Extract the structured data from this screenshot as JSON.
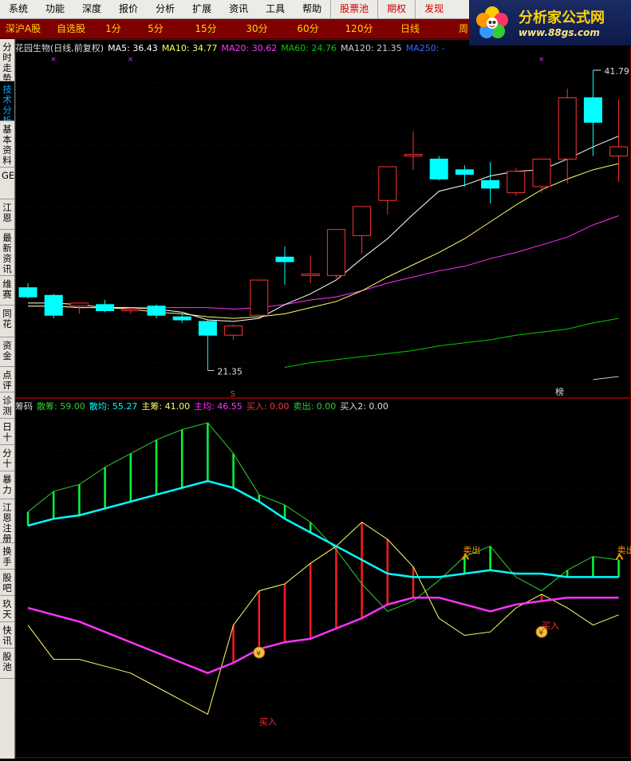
{
  "menu": {
    "items": [
      "系统",
      "功能",
      "深度",
      "报价",
      "分析",
      "扩展",
      "资讯",
      "工具",
      "帮助"
    ],
    "red_items": [
      "股票池",
      "期权",
      "发现"
    ]
  },
  "logo": {
    "title": "分析家公式网",
    "url": "www.88gs.com"
  },
  "periods": [
    "深沪A股",
    "自选股",
    "1分",
    "5分",
    "15分",
    "30分",
    "60分",
    "120分",
    "日线",
    "周"
  ],
  "left_tabs": [
    {
      "label": "分时走势",
      "state": "normal"
    },
    {
      "label": "技术分析",
      "state": "active"
    },
    {
      "label": "基本资料",
      "state": "normal"
    },
    {
      "label": "GET",
      "state": "normal"
    },
    {
      "label": "江恩",
      "state": "normal"
    },
    {
      "label": "最新资讯",
      "state": "normal"
    },
    {
      "label": "维赛",
      "state": "normal"
    },
    {
      "label": "同花",
      "state": "normal"
    },
    {
      "label": "资金",
      "state": "normal"
    },
    {
      "label": "点评",
      "state": "normal"
    },
    {
      "label": "诊测",
      "state": "normal"
    },
    {
      "label": "日十",
      "state": "normal"
    },
    {
      "label": "分十",
      "state": "normal"
    },
    {
      "label": "暴力",
      "state": "normal"
    },
    {
      "label": "江恩注册",
      "state": "normal"
    },
    {
      "label": "换手",
      "state": "normal"
    },
    {
      "label": "股吧",
      "state": "normal"
    },
    {
      "label": "玖天",
      "state": "normal"
    },
    {
      "label": "快讯",
      "state": "normal"
    },
    {
      "label": "股池",
      "state": "normal"
    }
  ],
  "main_info": {
    "title": "花园生物(日线,前复权)",
    "ma5": "MA5: 36.43",
    "ma10": "MA10: 34.77",
    "ma20": "MA20: 30.62",
    "ma60": "MA60: 24.76",
    "ma120": "MA120: 21.35",
    "ma250": "MA250: -"
  },
  "sub_info": {
    "title": "筹码",
    "sancou": "散筹: 59.00",
    "sanjun": "散均: 55.27",
    "zhucou": "主筹: 41.00",
    "zhujun": "主均: 46.55",
    "buy": "买入: 0.00",
    "sell": "卖出: 0.00",
    "buy2": "买入2: 0.00"
  },
  "annotations": {
    "high_label": "41.79",
    "low_label": "21.35",
    "s_marker": "S",
    "bang_marker": "榜",
    "buy_text": "买入",
    "sell_text": "卖出"
  },
  "colors": {
    "up": "#ff3333",
    "down": "#00ffff",
    "ma5": "#ffffff",
    "ma10": "#ffff66",
    "ma20": "#ff33ff",
    "ma60": "#00cc00",
    "ma120": "#cccccc",
    "chip_light": "#00ffff",
    "chip_main": "#ff33ff"
  },
  "candles": [
    {
      "o": 27.6,
      "h": 27.9,
      "l": 26.9,
      "c": 27.0
    },
    {
      "o": 27.1,
      "h": 27.2,
      "l": 25.6,
      "c": 25.8
    },
    {
      "o": 26.4,
      "h": 26.6,
      "l": 25.9,
      "c": 26.6
    },
    {
      "o": 26.5,
      "h": 26.8,
      "l": 26.0,
      "c": 26.1
    },
    {
      "o": 26.1,
      "h": 26.3,
      "l": 25.9,
      "c": 26.2
    },
    {
      "o": 26.4,
      "h": 26.5,
      "l": 25.6,
      "c": 25.8
    },
    {
      "o": 25.7,
      "h": 25.9,
      "l": 25.3,
      "c": 25.5
    },
    {
      "o": 25.4,
      "h": 25.5,
      "l": 22.2,
      "c": 24.5
    },
    {
      "o": 24.5,
      "h": 25.2,
      "l": 24.2,
      "c": 25.1
    },
    {
      "o": 25.8,
      "h": 28.1,
      "l": 25.8,
      "c": 28.1
    },
    {
      "o": 29.6,
      "h": 30.3,
      "l": 27.8,
      "c": 29.3
    },
    {
      "o": 28.4,
      "h": 29.7,
      "l": 27.9,
      "c": 28.5
    },
    {
      "o": 28.4,
      "h": 31.4,
      "l": 28.2,
      "c": 31.4
    },
    {
      "o": 31.0,
      "h": 32.9,
      "l": 29.8,
      "c": 32.9
    },
    {
      "o": 33.3,
      "h": 35.5,
      "l": 32.4,
      "c": 35.5
    },
    {
      "o": 36.3,
      "h": 37.8,
      "l": 35.3,
      "c": 36.3
    },
    {
      "o": 36.0,
      "h": 36.2,
      "l": 34.6,
      "c": 34.7
    },
    {
      "o": 35.3,
      "h": 35.6,
      "l": 34.2,
      "c": 35.0
    },
    {
      "o": 34.6,
      "h": 35.8,
      "l": 33.1,
      "c": 34.1
    },
    {
      "o": 33.8,
      "h": 35.4,
      "l": 33.6,
      "c": 35.2
    },
    {
      "o": 34.2,
      "h": 36.0,
      "l": 33.8,
      "c": 36.0
    },
    {
      "o": 36.0,
      "h": 40.6,
      "l": 34.4,
      "c": 40.0
    },
    {
      "o": 40.0,
      "h": 41.8,
      "l": 36.2,
      "c": 38.4
    },
    {
      "o": 36.2,
      "h": 39.9,
      "l": 34.5,
      "c": 36.8
    }
  ],
  "ma_lines": {
    "ma5": [
      26.6,
      26.6,
      26.5,
      26.3,
      26.3,
      26.2,
      26.0,
      25.5,
      25.4,
      25.6,
      26.5,
      27.2,
      28.1,
      29.5,
      30.8,
      32.4,
      33.9,
      34.3,
      34.9,
      35.2,
      35.3,
      36.0,
      36.8,
      37.5
    ],
    "ma10": [
      26.4,
      26.4,
      26.3,
      26.3,
      26.2,
      26.0,
      25.9,
      25.7,
      25.6,
      25.7,
      25.9,
      26.3,
      26.7,
      27.4,
      28.3,
      29.1,
      29.9,
      30.8,
      31.9,
      33.0,
      34.0,
      34.7,
      35.3,
      35.7
    ],
    "ma20": [
      26.4,
      26.4,
      26.3,
      26.3,
      26.3,
      26.3,
      26.3,
      26.3,
      26.2,
      26.3,
      26.5,
      26.8,
      27.0,
      27.4,
      27.9,
      28.3,
      28.7,
      29.0,
      29.5,
      29.9,
      30.4,
      30.9,
      31.7,
      32.3
    ],
    "ma60": [
      null,
      null,
      null,
      null,
      null,
      null,
      null,
      null,
      null,
      null,
      22.4,
      22.7,
      22.9,
      23.1,
      23.3,
      23.5,
      23.8,
      24.0,
      24.2,
      24.5,
      24.7,
      24.9,
      25.3,
      25.6
    ],
    "ma120": [
      null,
      null,
      null,
      null,
      null,
      null,
      null,
      null,
      null,
      null,
      null,
      null,
      null,
      null,
      null,
      null,
      null,
      null,
      null,
      null,
      null,
      null,
      21.6,
      21.8
    ]
  },
  "chips": {
    "light_avg": [
      67,
      69,
      70,
      72,
      74,
      76,
      78,
      80,
      78,
      74,
      69,
      65,
      61,
      57,
      53,
      52,
      52,
      53,
      54,
      53,
      53,
      52,
      52,
      52
    ],
    "light_peak": [
      71,
      77,
      79,
      84,
      88,
      92,
      95,
      97,
      88,
      76,
      73,
      68,
      60,
      50,
      42,
      45,
      51,
      58,
      61,
      52,
      48,
      54,
      58,
      57
    ],
    "main_avg": [
      43,
      41,
      39,
      36,
      33,
      30,
      27,
      24,
      27,
      31,
      33,
      34,
      37,
      40,
      44,
      46,
      46,
      44,
      42,
      44,
      45,
      46,
      46,
      46
    ],
    "main_peak": [
      38,
      28,
      28,
      26,
      24,
      20,
      16,
      12,
      38,
      48,
      50,
      56,
      61,
      68,
      63,
      55,
      40,
      35,
      36,
      43,
      47,
      43,
      38,
      41
    ]
  }
}
